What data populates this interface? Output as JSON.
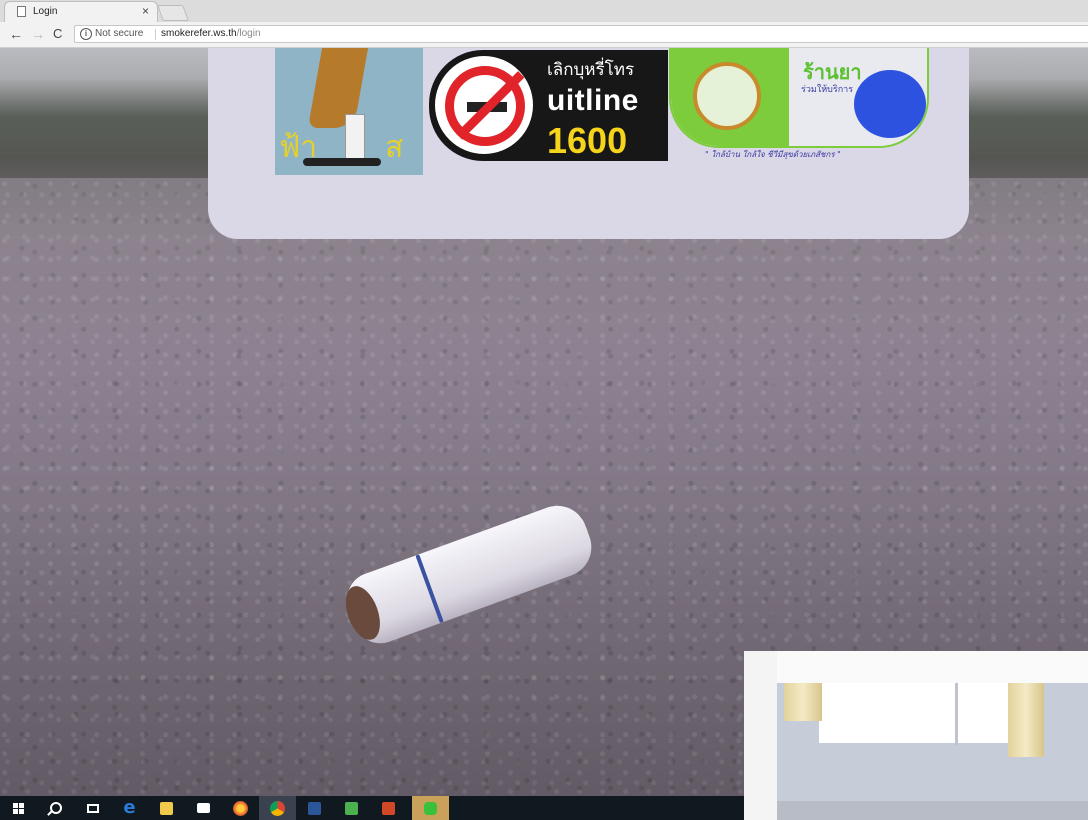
{
  "browser": {
    "tab": {
      "title": "Login",
      "close": "×"
    },
    "nav": {
      "back": "←",
      "forward": "→",
      "reload": "C"
    },
    "address": {
      "info_icon": "i",
      "security_text": "Not secure",
      "host": "smokerefer.ws.th",
      "path": "/login"
    }
  },
  "header": {
    "smoker_logo": {
      "text_left": "ฟ้า",
      "text_right": "ส"
    },
    "quitline_logo": {
      "thai_text": "เลิกบุหรี่โทร",
      "name": "uitline",
      "number": "1600"
    },
    "pharmacy_logo": {
      "title": "ร้านยา",
      "subtitle": "ร่วมให้บริการ",
      "caption": "\" ใกล้บ้าน ใกล้ใจ ชีวีมีสุขด้วยเภสัชกร \""
    }
  },
  "taskbar": {
    "items": [
      {
        "name": "start-icon"
      },
      {
        "name": "search-icon"
      },
      {
        "name": "task-view-icon"
      },
      {
        "name": "edge-icon",
        "glyph": "e"
      },
      {
        "name": "file-explorer-icon",
        "color": "#f0c94a"
      },
      {
        "name": "mail-icon",
        "color": "#ffffff"
      },
      {
        "name": "firefox-icon",
        "color": "#e8692a"
      },
      {
        "name": "chrome-icon",
        "color": "#4a9e47",
        "active": true
      },
      {
        "name": "word-icon",
        "color": "#2b579a"
      },
      {
        "name": "excel-icon",
        "color": "#4caf50"
      },
      {
        "name": "powerpoint-icon",
        "color": "#d24726"
      },
      {
        "name": "line-icon",
        "color": "#3ac13a"
      }
    ]
  }
}
